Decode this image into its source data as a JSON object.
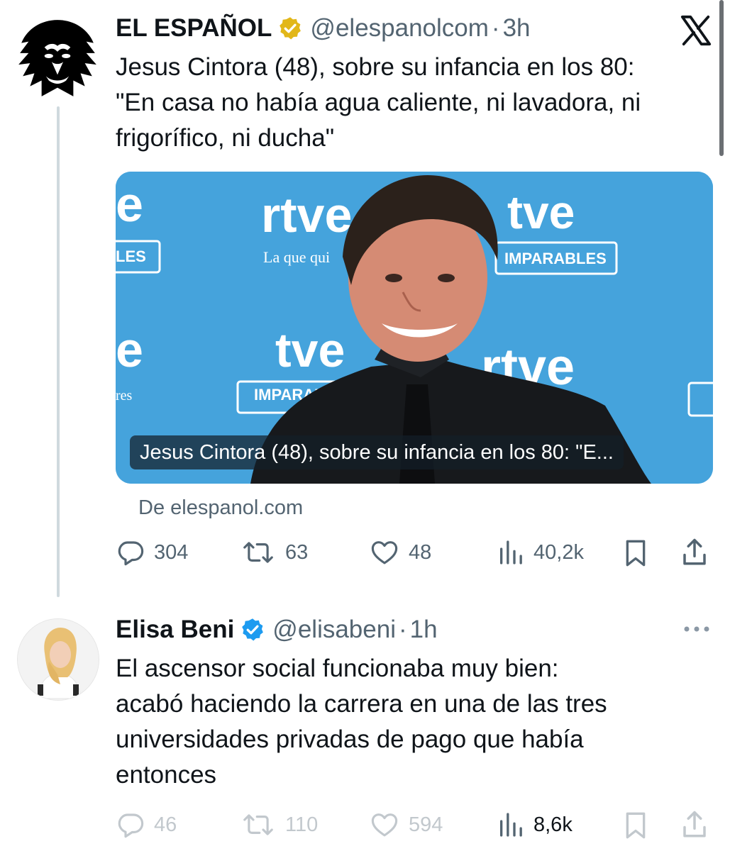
{
  "tweet1": {
    "author_name": "EL ESPAÑOL",
    "handle": "@elespanolcom",
    "separator": "·",
    "time": "3h",
    "text_lines": [
      "Jesus Cintora (48), sobre su infancia en los 80:",
      "\"En casa no había agua caliente, ni lavadora, ni",
      "frigorífico, ni ducha\""
    ],
    "card": {
      "image_caption": "Jesus Cintora (48), sobre su infancia en los 80: \"E...",
      "backdrop_texts": [
        "rtve",
        "tve",
        "La que qui",
        "IMPARABLES",
        "LES",
        "tve",
        "rtve",
        "IMPARABL",
        "e",
        "e",
        "res"
      ],
      "source": "De elespanol.com"
    },
    "stats": {
      "replies": "304",
      "reposts": "63",
      "likes": "48",
      "views": "40,2k"
    }
  },
  "tweet2": {
    "author_name": "Elisa Beni",
    "handle": "@elisabeni",
    "separator": "·",
    "time": "1h",
    "text_lines": [
      "El ascensor social funcionaba muy bien:",
      "acabó haciendo la carrera en una de las tres",
      "universidades privadas de pago que había",
      "entonces"
    ],
    "stats": {
      "replies": "46",
      "reposts": "110",
      "likes": "594",
      "views": "8,6k"
    }
  },
  "icons": {
    "logo": "x-logo-icon",
    "verified": "verified-badge-icon",
    "reply": "reply-icon",
    "repost": "repost-icon",
    "like": "heart-icon",
    "views": "views-icon",
    "bookmark": "bookmark-icon",
    "share": "share-icon",
    "more": "more-dots-icon"
  },
  "colors": {
    "gold_badge": "#e2b719",
    "blue_badge": "#1d9bf0",
    "muted": "#536471",
    "rtve_blue": "#45a3dc"
  }
}
